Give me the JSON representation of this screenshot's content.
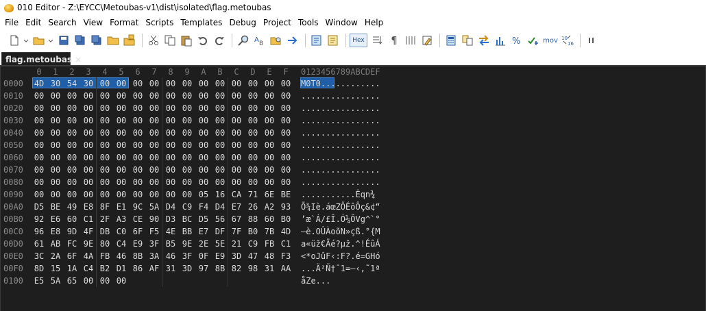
{
  "window": {
    "title": "010 Editor - Z:\\EYCC\\Metoubas-v1\\dist\\isolated\\flag.metoubas"
  },
  "menu": [
    "File",
    "Edit",
    "Search",
    "View",
    "Format",
    "Scripts",
    "Templates",
    "Debug",
    "Project",
    "Tools",
    "Window",
    "Help"
  ],
  "toolbar": {
    "hex_label": "Hex",
    "mov_label": "mov",
    "pilcrow": "¶"
  },
  "tab": {
    "name": "flag.metoubas",
    "close": "×"
  },
  "hex": {
    "column_headers": [
      "0",
      "1",
      "2",
      "3",
      "4",
      "5",
      "6",
      "7",
      "8",
      "9",
      "A",
      "B",
      "C",
      "D",
      "E",
      "F"
    ],
    "ascii_header": "0123456789ABCDEF",
    "selection": {
      "bytes": 6,
      "start_offset": "0000"
    },
    "rows": [
      {
        "addr": "0000",
        "bytes": [
          "4D",
          "30",
          "54",
          "30",
          "00",
          "00",
          "00",
          "00",
          "00",
          "00",
          "00",
          "00",
          "00",
          "00",
          "00",
          "00"
        ],
        "ascii": "M0T0............"
      },
      {
        "addr": "0010",
        "bytes": [
          "00",
          "00",
          "00",
          "00",
          "00",
          "00",
          "00",
          "00",
          "00",
          "00",
          "00",
          "00",
          "00",
          "00",
          "00",
          "00"
        ],
        "ascii": "................"
      },
      {
        "addr": "0020",
        "bytes": [
          "00",
          "00",
          "00",
          "00",
          "00",
          "00",
          "00",
          "00",
          "00",
          "00",
          "00",
          "00",
          "00",
          "00",
          "00",
          "00"
        ],
        "ascii": "................"
      },
      {
        "addr": "0030",
        "bytes": [
          "00",
          "00",
          "00",
          "00",
          "00",
          "00",
          "00",
          "00",
          "00",
          "00",
          "00",
          "00",
          "00",
          "00",
          "00",
          "00"
        ],
        "ascii": "................"
      },
      {
        "addr": "0040",
        "bytes": [
          "00",
          "00",
          "00",
          "00",
          "00",
          "00",
          "00",
          "00",
          "00",
          "00",
          "00",
          "00",
          "00",
          "00",
          "00",
          "00"
        ],
        "ascii": "................"
      },
      {
        "addr": "0050",
        "bytes": [
          "00",
          "00",
          "00",
          "00",
          "00",
          "00",
          "00",
          "00",
          "00",
          "00",
          "00",
          "00",
          "00",
          "00",
          "00",
          "00"
        ],
        "ascii": "................"
      },
      {
        "addr": "0060",
        "bytes": [
          "00",
          "00",
          "00",
          "00",
          "00",
          "00",
          "00",
          "00",
          "00",
          "00",
          "00",
          "00",
          "00",
          "00",
          "00",
          "00"
        ],
        "ascii": "................"
      },
      {
        "addr": "0070",
        "bytes": [
          "00",
          "00",
          "00",
          "00",
          "00",
          "00",
          "00",
          "00",
          "00",
          "00",
          "00",
          "00",
          "00",
          "00",
          "00",
          "00"
        ],
        "ascii": "................"
      },
      {
        "addr": "0080",
        "bytes": [
          "00",
          "00",
          "00",
          "00",
          "00",
          "00",
          "00",
          "00",
          "00",
          "00",
          "00",
          "00",
          "00",
          "00",
          "00",
          "00"
        ],
        "ascii": "................"
      },
      {
        "addr": "0090",
        "bytes": [
          "00",
          "00",
          "00",
          "00",
          "00",
          "00",
          "00",
          "00",
          "00",
          "00",
          "05",
          "16",
          "CA",
          "71",
          "6E",
          "BE"
        ],
        "ascii": "...........Êqn¾"
      },
      {
        "addr": "00A0",
        "bytes": [
          "D5",
          "BE",
          "49",
          "E8",
          "8F",
          "E1",
          "9C",
          "5A",
          "D4",
          "C9",
          "F4",
          "D4",
          "E7",
          "26",
          "A2",
          "93"
        ],
        "ascii": "Õ¾Iè.áœZÔÉôÔç&¢“"
      },
      {
        "addr": "00B0",
        "bytes": [
          "92",
          "E6",
          "60",
          "C1",
          "2F",
          "A3",
          "CE",
          "90",
          "D3",
          "BC",
          "D5",
          "56",
          "67",
          "88",
          "60",
          "B0"
        ],
        "ascii": "’æ`Á/£Î.Ó¼ÕVg^`°"
      },
      {
        "addr": "00C0",
        "bytes": [
          "96",
          "E8",
          "9D",
          "4F",
          "DB",
          "C0",
          "6F",
          "F5",
          "4E",
          "BB",
          "E7",
          "DF",
          "7F",
          "B0",
          "7B",
          "4D"
        ],
        "ascii": "–è.OÛÀoõN»çß.°{M"
      },
      {
        "addr": "00D0",
        "bytes": [
          "61",
          "AB",
          "FC",
          "9E",
          "80",
          "C4",
          "E9",
          "3F",
          "B5",
          "9E",
          "2E",
          "5E",
          "21",
          "C9",
          "FB",
          "C1"
        ],
        "ascii": "a«üž€Äé?µž.^!ÉûÁ"
      },
      {
        "addr": "00E0",
        "bytes": [
          "3C",
          "2A",
          "6F",
          "4A",
          "FB",
          "46",
          "8B",
          "3A",
          "46",
          "3F",
          "0F",
          "E9",
          "3D",
          "47",
          "48",
          "F3"
        ],
        "ascii": "<*oJûF‹:F?.é=GHó"
      },
      {
        "addr": "00F0",
        "bytes": [
          "8D",
          "15",
          "1A",
          "C4",
          "B2",
          "D1",
          "86",
          "AF",
          "31",
          "3D",
          "97",
          "8B",
          "82",
          "98",
          "31",
          "AA"
        ],
        "ascii": "...Ä²Ñ†¯1=—‹‚˜1ª"
      },
      {
        "addr": "0100",
        "bytes": [
          "E5",
          "5A",
          "65",
          "00",
          "00",
          "00"
        ],
        "ascii": "åZe..."
      }
    ]
  }
}
